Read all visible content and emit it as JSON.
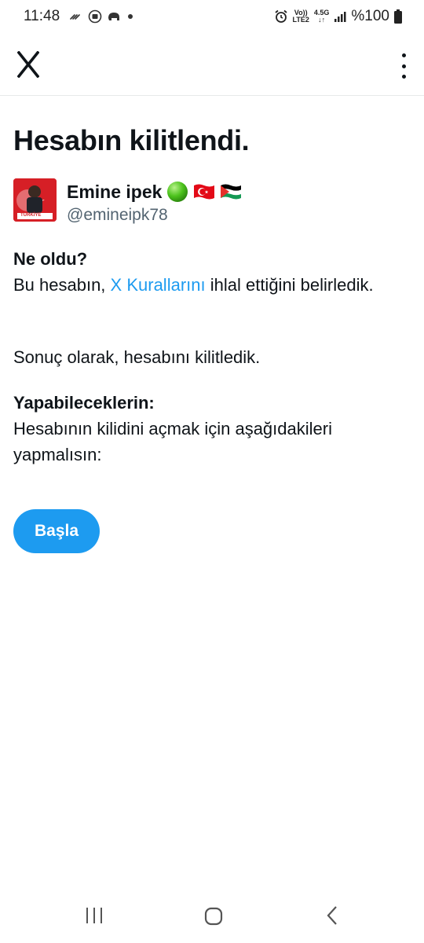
{
  "status_bar": {
    "time": "11:48",
    "network_top": "Vo))",
    "network_bottom": "LTE2",
    "data_type": "4.5G",
    "battery": "%100"
  },
  "top_bar": {
    "logo": "X"
  },
  "page": {
    "title": "Hesabın kilitlendi."
  },
  "profile": {
    "name": "Emine ipek",
    "handle": "@emineipk78",
    "avatar_text": "TÜRKİYE"
  },
  "what_happened": {
    "heading": "Ne oldu?",
    "text_before": "Bu hesabın, ",
    "link": "X Kurallarını",
    "text_after": " ihlal ettiğini belirledik.",
    "result": "Sonuç olarak, hesabını kilitledik."
  },
  "what_you_can_do": {
    "heading": "Yapabileceklerin:",
    "text": "Hesabının kilidini açmak için aşağıdakileri yapmalısın:"
  },
  "actions": {
    "start_label": "Başla"
  },
  "colors": {
    "accent": "#1d9bf0",
    "text": "#0f1419",
    "secondary": "#536471"
  }
}
